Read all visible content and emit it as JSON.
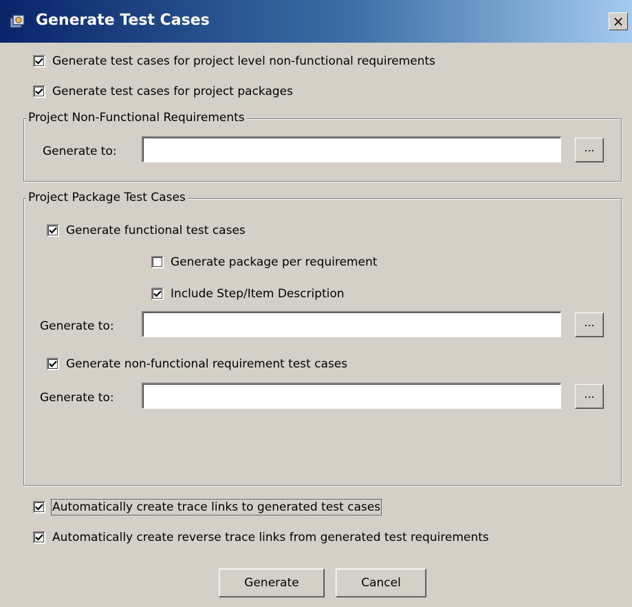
{
  "window": {
    "title": "Generate Test Cases",
    "close_label": "×"
  },
  "options": {
    "project_level_nfr": {
      "label": "Generate test cases for project level non-functional requirements",
      "checked": true
    },
    "project_packages": {
      "label": "Generate test cases for project packages",
      "checked": true
    }
  },
  "nfr_group": {
    "title": "Project Non-Functional Requirements",
    "generate_to_label": "Generate to:",
    "generate_to_value": "",
    "browse_label": "..."
  },
  "package_group": {
    "title": "Project Package Test Cases",
    "functional": {
      "label": "Generate functional test cases",
      "checked": true
    },
    "package_per_req": {
      "label": "Generate package per requirement",
      "checked": false
    },
    "include_step": {
      "label": "Include Step/Item Description",
      "checked": true
    },
    "functional_generate_to_label": "Generate to:",
    "functional_generate_to_value": "",
    "nonfunctional": {
      "label": "Generate non-functional requirement test cases",
      "checked": true
    },
    "nonfunctional_generate_to_label": "Generate to:",
    "nonfunctional_generate_to_value": "",
    "browse_label": "..."
  },
  "trace": {
    "auto_trace": {
      "label": "Automatically create trace links to generated test cases",
      "checked": true
    },
    "reverse_trace": {
      "label": "Automatically create reverse trace links from generated test requirements",
      "checked": true
    }
  },
  "buttons": {
    "generate": "Generate",
    "cancel": "Cancel"
  }
}
